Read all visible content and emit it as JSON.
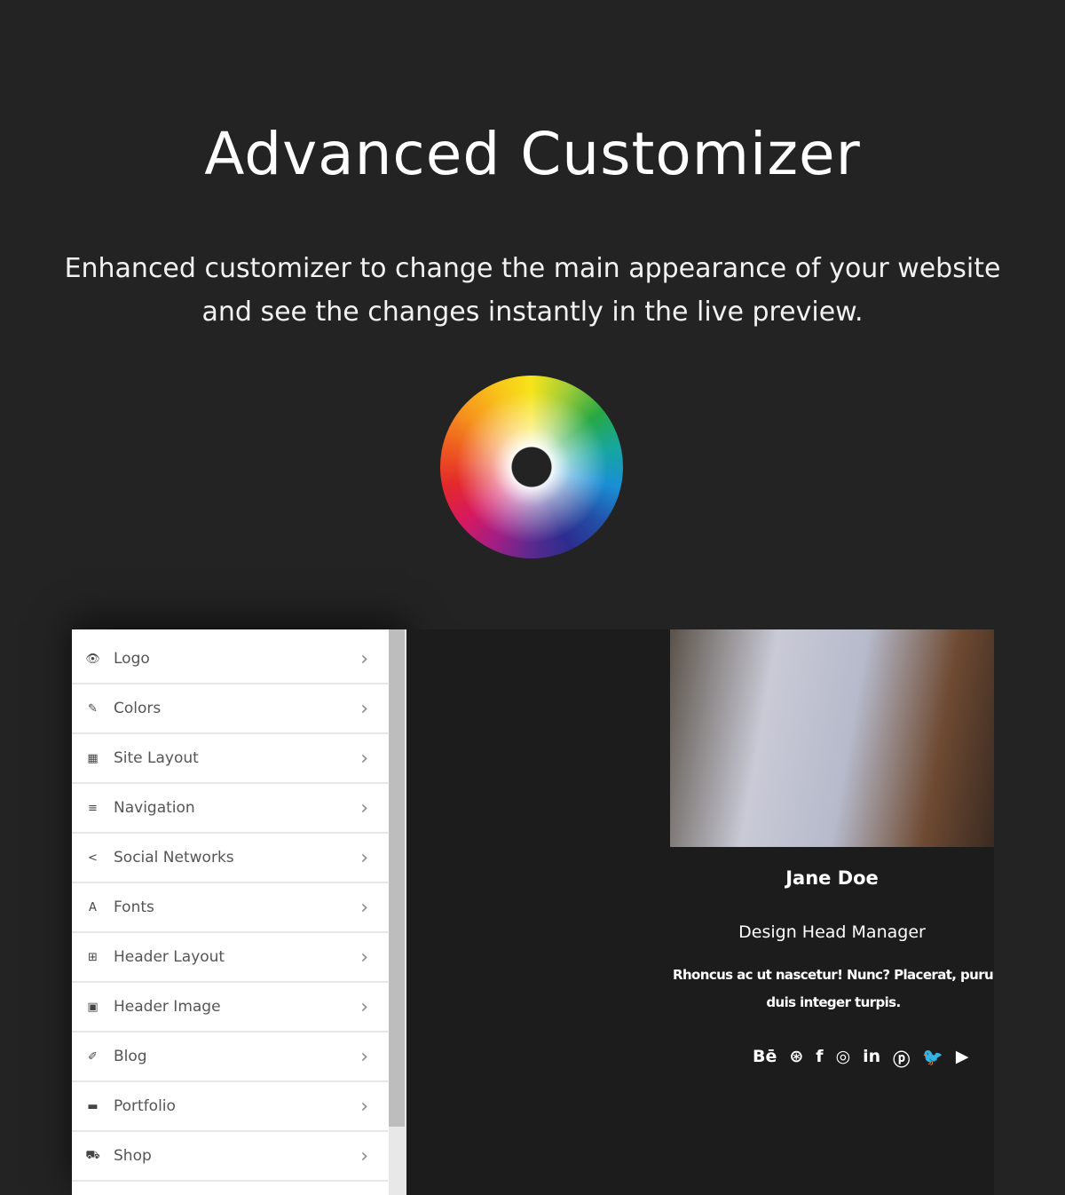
{
  "hero": {
    "title": "Advanced Customizer",
    "subtitle_line1": "Enhanced customizer to change the main appearance of your website",
    "subtitle_line2": "and see the changes instantly in the live preview."
  },
  "panel": {
    "items": [
      {
        "label": "Logo",
        "icon": "eye-icon",
        "glyph": "👁"
      },
      {
        "label": "Colors",
        "icon": "brush-icon",
        "glyph": "✎"
      },
      {
        "label": "Site Layout",
        "icon": "layout-icon",
        "glyph": "▦"
      },
      {
        "label": "Navigation",
        "icon": "menu-icon",
        "glyph": "≡"
      },
      {
        "label": "Social Networks",
        "icon": "share-icon",
        "glyph": "<"
      },
      {
        "label": "Fonts",
        "icon": "font-icon",
        "glyph": "A"
      },
      {
        "label": "Header Layout",
        "icon": "table-icon",
        "glyph": "⊞"
      },
      {
        "label": "Header Image",
        "icon": "image-icon",
        "glyph": "▣"
      },
      {
        "label": "Blog",
        "icon": "edit-icon",
        "glyph": "✐"
      },
      {
        "label": "Portfolio",
        "icon": "folder-icon",
        "glyph": "▬"
      },
      {
        "label": "Shop",
        "icon": "cart-icon",
        "glyph": "⛟"
      }
    ]
  },
  "preview": {
    "name": "Jane Doe",
    "role": "Design Head Manager",
    "desc1": "Rhoncus ac ut nascetur! Nunc? Placerat, purus nisi t",
    "desc2": "duis integer turpis.",
    "socials": [
      {
        "icon": "behance-icon",
        "glyph": "Bē"
      },
      {
        "icon": "dribbble-icon",
        "glyph": "⊛"
      },
      {
        "icon": "facebook-icon",
        "glyph": "f"
      },
      {
        "icon": "instagram-icon",
        "glyph": "◎"
      },
      {
        "icon": "linkedin-icon",
        "glyph": "in"
      },
      {
        "icon": "pinterest-icon",
        "glyph": "ⓟ"
      },
      {
        "icon": "twitter-icon",
        "glyph": "🐦"
      },
      {
        "icon": "youtube-icon",
        "glyph": "▶"
      }
    ]
  }
}
